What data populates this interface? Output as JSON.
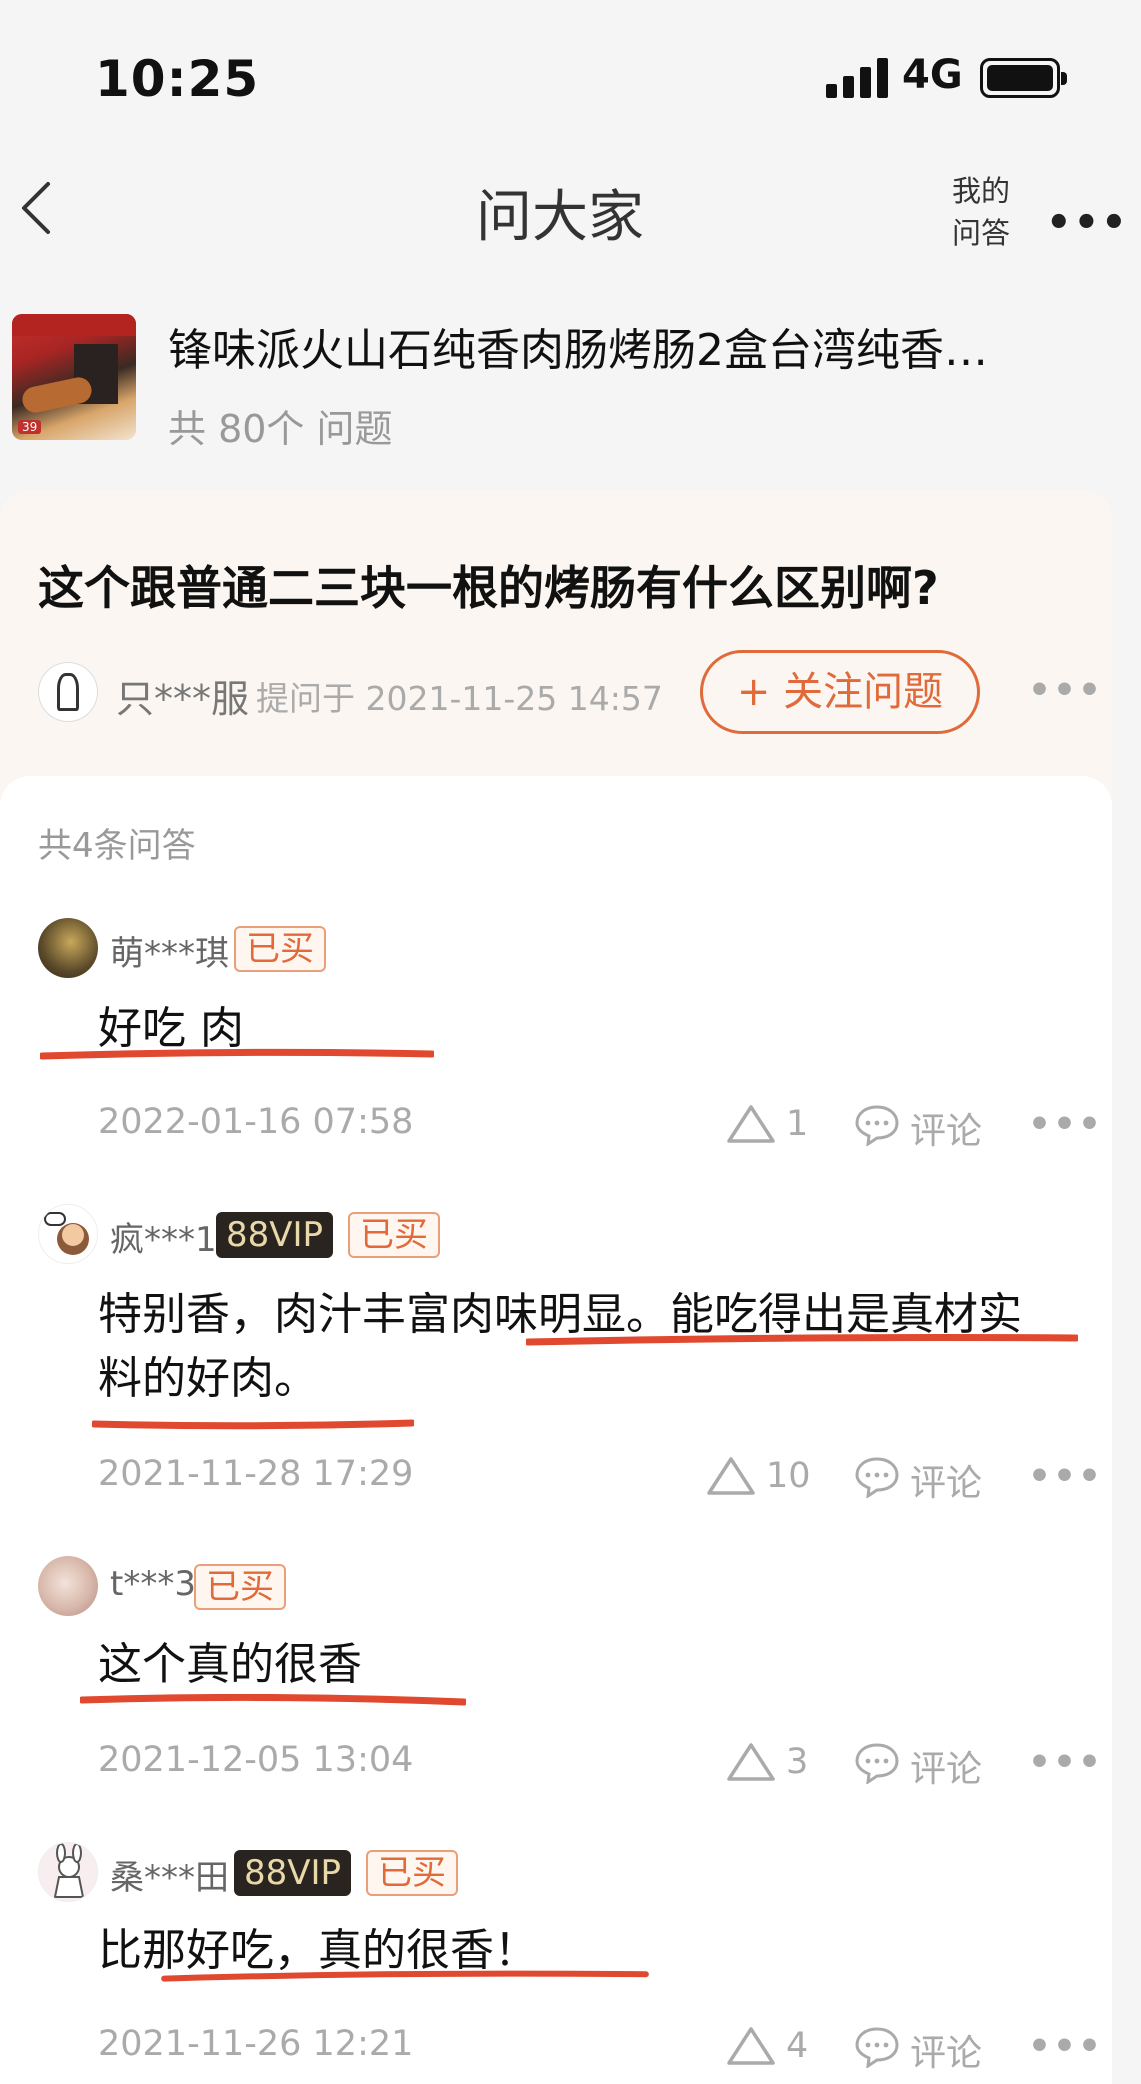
{
  "status_bar": {
    "time": "10:25",
    "network": "4G"
  },
  "nav": {
    "title": "问大家",
    "my_qa_line1": "我的",
    "my_qa_line2": "问答",
    "more": "•••"
  },
  "product": {
    "name": "锋味派火山石纯香肉肠烤肠2盒台湾纯香…",
    "question_count": "共 80个 问题",
    "thumb_price": "39"
  },
  "question": {
    "text": "这个跟普通二三块一根的烤肠有什么区别啊?",
    "asker": "只***服",
    "meta": "提问于 2021-11-25 14:57",
    "follow_label": "+ 关注问题",
    "more": "•••"
  },
  "answers_total": "共4条问答",
  "answers": [
    {
      "user": "萌***琪",
      "vip": "",
      "bought": "已买",
      "text": "好吃 肉",
      "text2": "",
      "date": "2022-01-16 07:58",
      "likes": "1",
      "comment": "评论",
      "more": "•••"
    },
    {
      "user": "疯***1",
      "vip": "88VIP",
      "bought": "已买",
      "text": "特别香，肉汁丰富肉味明显。能吃得出是真材实",
      "text2": "料的好肉。",
      "date": "2021-11-28 17:29",
      "likes": "10",
      "comment": "评论",
      "more": "•••"
    },
    {
      "user": "t***3",
      "vip": "",
      "bought": "已买",
      "text": "这个真的很香",
      "text2": "",
      "date": "2021-12-05 13:04",
      "likes": "3",
      "comment": "评论",
      "more": "•••"
    },
    {
      "user": "桑***田",
      "vip": "88VIP",
      "bought": "已买",
      "text": "比那好吃，真的很香！",
      "text2": "",
      "date": "2021-11-26 12:21",
      "likes": "4",
      "comment": "评论",
      "more": "•••"
    }
  ],
  "colors": {
    "accent": "#e06a3a",
    "underline": "#e0492f"
  }
}
